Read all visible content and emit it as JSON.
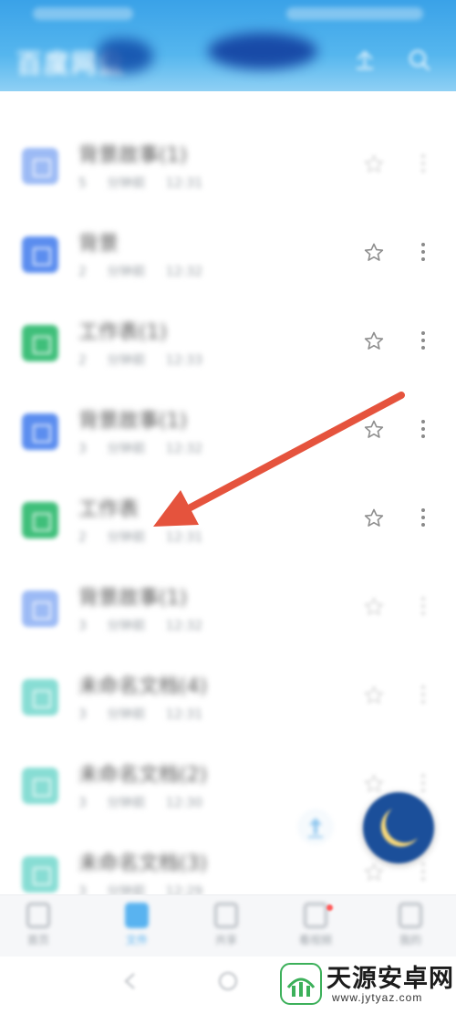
{
  "header": {
    "title": "百度网盘",
    "upload_icon": "upload-icon",
    "search_icon": "search-icon",
    "background": "#3aa2e8"
  },
  "files": [
    {
      "name": "背景故事(1)",
      "meta": "5 分钟前  12:31",
      "type_color": "#5b8def",
      "icon": "document-icon",
      "faded": true
    },
    {
      "name": "背景",
      "meta": "2 分钟前  12:32",
      "type_color": "#5b8def",
      "icon": "document-icon",
      "faded": false
    },
    {
      "name": "工作表(1)",
      "meta": "2 分钟前  12:33",
      "type_color": "#3fbf7a",
      "icon": "spreadsheet-icon",
      "faded": false
    },
    {
      "name": "背景故事(1)",
      "meta": "3 分钟前  12:32",
      "type_color": "#5b8def",
      "icon": "document-icon",
      "faded": false
    },
    {
      "name": "工作表",
      "meta": "2 分钟前  12:31",
      "type_color": "#3fbf7a",
      "icon": "spreadsheet-icon",
      "faded": false
    },
    {
      "name": "背景故事(1)",
      "meta": "3 分钟前  12:32",
      "type_color": "#5b8def",
      "icon": "document-icon",
      "faded": true
    },
    {
      "name": "未命名文档(4)",
      "meta": "3 分钟前  12:31",
      "type_color": "#39c7b8",
      "icon": "document-icon",
      "faded": true
    },
    {
      "name": "未命名文档(2)",
      "meta": "3 分钟前  12:30",
      "type_color": "#39c7b8",
      "icon": "document-icon",
      "faded": true
    },
    {
      "name": "未命名文档(3)",
      "meta": "3 分钟前  12:29",
      "type_color": "#39c7b8",
      "icon": "document-icon",
      "faded": true
    }
  ],
  "bottom_nav": [
    {
      "label": "首页",
      "icon": "home-icon",
      "active": false
    },
    {
      "label": "文件",
      "icon": "folder-icon",
      "active": true
    },
    {
      "label": "共享",
      "icon": "share-icon",
      "active": false
    },
    {
      "label": "看视频",
      "icon": "video-icon",
      "active": false
    },
    {
      "label": "我的",
      "icon": "profile-icon",
      "active": false
    }
  ],
  "floating": {
    "transfer_icon": "transfer-icon",
    "night_mode_icon": "moon-icon",
    "night_mode_color": "#1b4f9a"
  },
  "annotation": {
    "arrow_color": "#e5533d"
  },
  "watermark": {
    "text": "天源安卓网",
    "url": "www.jytyaz.com",
    "logo_color": "#3cb05a"
  },
  "system_nav": {
    "back_icon": "back-icon",
    "home_icon": "home-circle-icon"
  }
}
